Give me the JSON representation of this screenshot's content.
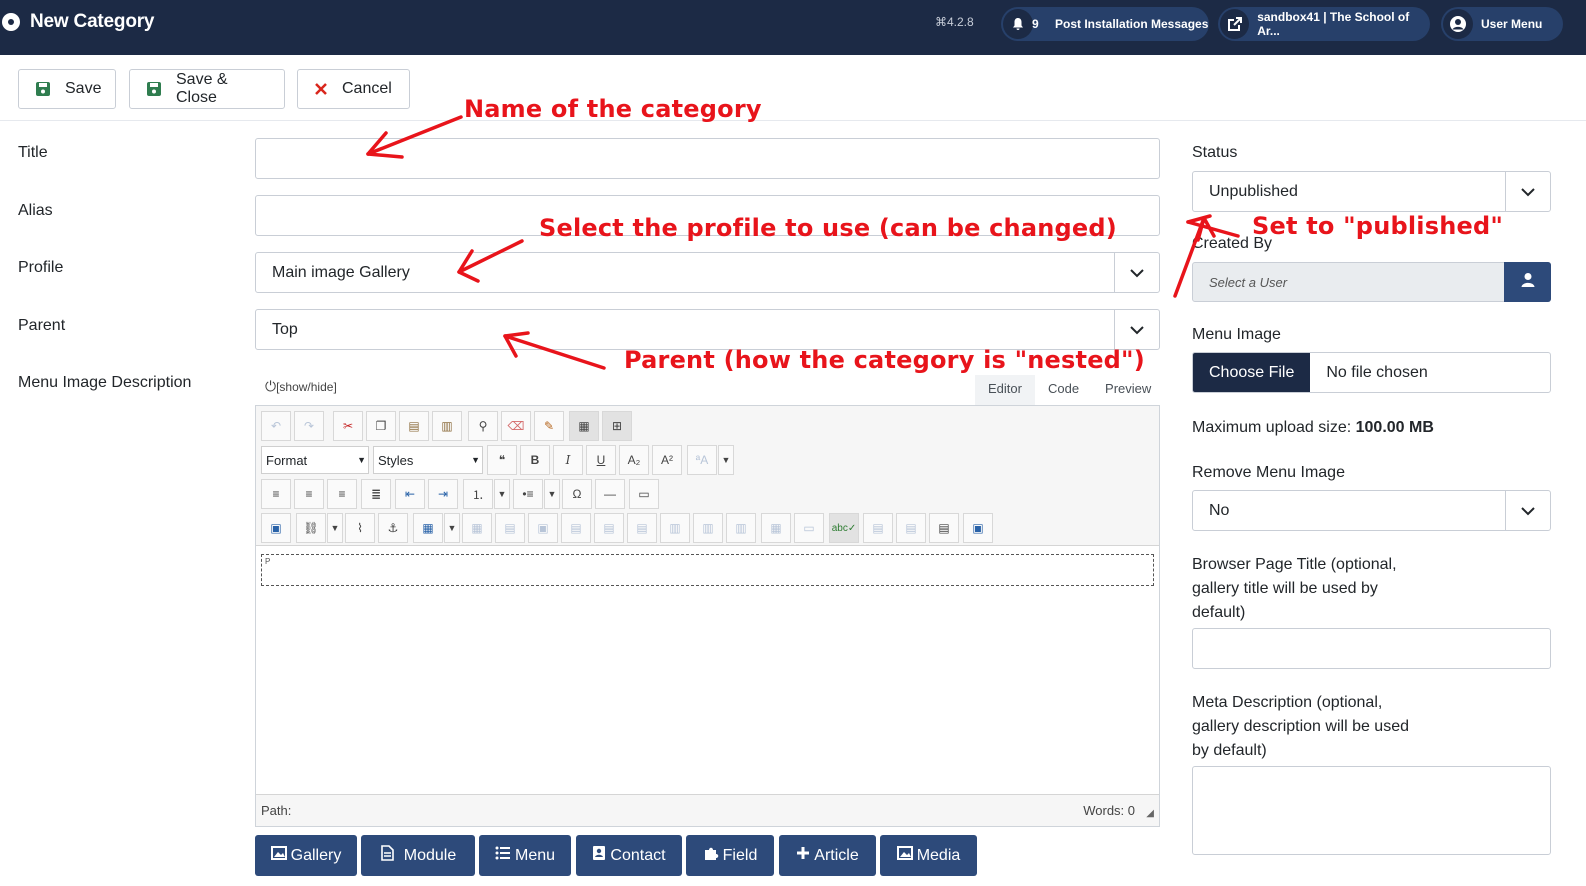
{
  "header": {
    "title": "New Category",
    "version": "4.2.8",
    "notifications_count": "9",
    "post_install_label": "Post Installation Messages",
    "site_label": "sandbox41 | The School of Ar...",
    "user_menu_label": "User Menu"
  },
  "toolbar": {
    "save_label": "Save",
    "save_close_label": "Save & Close",
    "cancel_label": "Cancel"
  },
  "form": {
    "title_label": "Title",
    "title_value": "",
    "alias_label": "Alias",
    "alias_value": "",
    "profile_label": "Profile",
    "profile_value": "Main image Gallery",
    "parent_label": "Parent",
    "parent_value": "Top",
    "menu_image_desc_label": "Menu Image Description"
  },
  "editor": {
    "show_hide": "[show/hide]",
    "tabs": [
      "Editor",
      "Code",
      "Preview"
    ],
    "format_label": "Format",
    "styles_label": "Styles",
    "content_tag": "P",
    "path_label": "Path:",
    "words_label": "Words: 0"
  },
  "insert_buttons": [
    "Gallery",
    "Module",
    "Menu",
    "Contact",
    "Field",
    "Article",
    "Media"
  ],
  "sidebar": {
    "status_label": "Status",
    "status_value": "Unpublished",
    "created_by_label": "Created By",
    "created_by_placeholder": "Select a User",
    "menu_image_label": "Menu Image",
    "choose_file_label": "Choose File",
    "no_file_label": "No file chosen",
    "max_upload_label": "Maximum upload size:",
    "max_upload_value": "100.00 MB",
    "remove_menu_image_label": "Remove Menu Image",
    "remove_menu_image_value": "No",
    "browser_title_label": "Browser Page Title (optional, gallery title will be used by default)",
    "meta_desc_label": "Meta Description (optional, gallery description will be used by default)"
  },
  "annotations": {
    "name_of_category": "Name of the category",
    "select_profile": "Select the profile to use (can be changed)",
    "parent_note": "Parent (how the category is \"nested\")",
    "set_published": "Set to \"published\""
  },
  "colors": {
    "header_bg": "#1c2a45",
    "button_blue": "#2d4a7a",
    "annotation_red": "#e8141b",
    "save_green": "#2f7d4f"
  }
}
